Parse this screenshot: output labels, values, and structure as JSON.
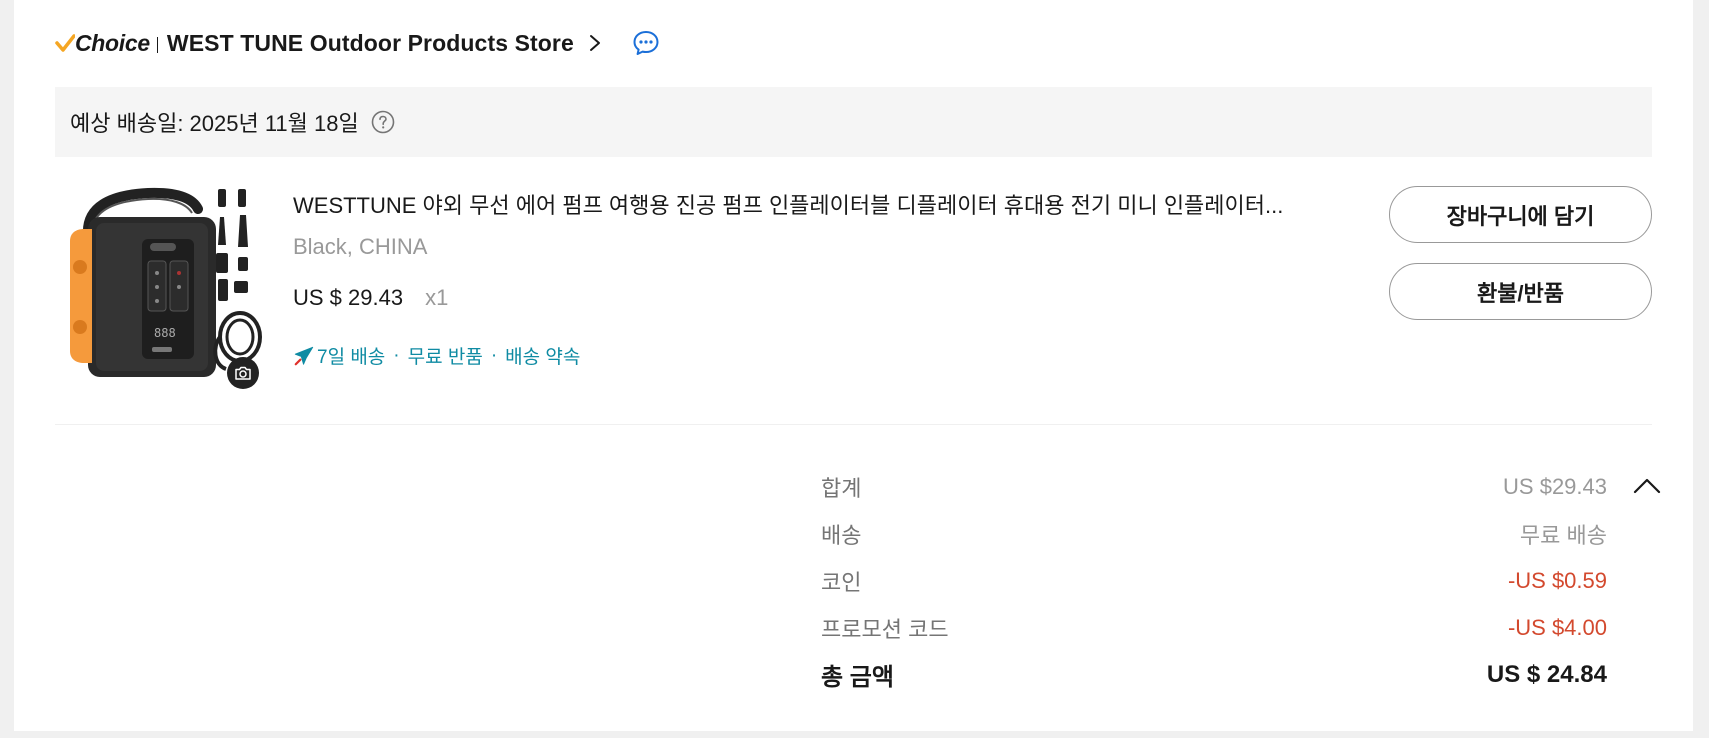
{
  "store": {
    "choice_label": "Choice",
    "name": "WEST TUNE Outdoor Products Store"
  },
  "delivery": {
    "estimate": "예상 배송일: 2025년 11월 18일"
  },
  "product": {
    "title": "WESTTUNE 야외 무선 에어 펌프 여행용 진공 펌프 인플레이터블 디플레이터 휴대용 전기 미니 인플레이터...",
    "variant": "Black, CHINA",
    "price": "US $ 29.43",
    "quantity": "x1",
    "perks": [
      "7일 배송",
      "무료 반품",
      "배송 약속"
    ],
    "perk_separator": "·"
  },
  "actions": {
    "add_to_cart": "장바구니에 담기",
    "refund_return": "환불/반품"
  },
  "summary": {
    "subtotal_label": "합계",
    "subtotal_value": "US $29.43",
    "shipping_label": "배송",
    "shipping_value": "무료 배송",
    "coins_label": "코인",
    "coins_value": "-US $0.59",
    "promo_label": "프로모션 코드",
    "promo_value": "-US $4.00",
    "total_label": "총 금액",
    "total_value": "US $ 24.84"
  },
  "colors": {
    "accent_teal": "#0f8ba3",
    "discount_red": "#d3492e",
    "choice_check": "#f5a623",
    "product_orange": "#f59a3c"
  }
}
